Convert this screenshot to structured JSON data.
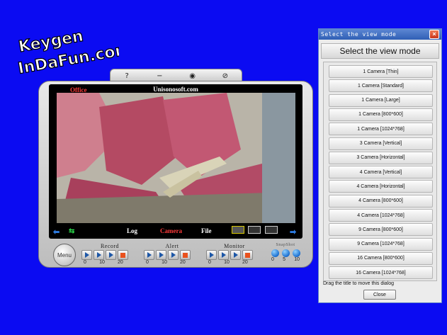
{
  "watermark": {
    "line1": "Keygen",
    "line2": "InDaFun.com"
  },
  "camera_app": {
    "toolbar": {
      "icons": [
        "help-icon",
        "minimize-icon",
        "snapshot-icon",
        "close-icon"
      ],
      "glyphs": [
        "?",
        "−",
        "◉",
        "⊘"
      ]
    },
    "screen_title": "Unisonosoft.com",
    "location_label": "Office",
    "status": {
      "log": "Log",
      "camera": "Camera",
      "file": "File"
    },
    "menu_label": "Menu",
    "record": {
      "title": "Record",
      "ticks": [
        "0",
        "10",
        "20"
      ]
    },
    "alert": {
      "title": "Alert",
      "ticks": [
        "0",
        "10",
        "20"
      ]
    },
    "monitor": {
      "title": "Monitor",
      "ticks": [
        "0",
        "10",
        "20"
      ]
    },
    "snapshot": {
      "title": "SnapShot",
      "ticks": [
        "0",
        "5",
        "10"
      ]
    }
  },
  "dialog": {
    "title": "Select the view mode",
    "heading": "Select the view mode",
    "options": [
      "1 Camera [Thin]",
      "1 Camera [Standard]",
      "1 Camera [Large]",
      "1 Camera [800*600]",
      "1 Camera [1024*768]",
      "3 Camera [Vertical]",
      "3 Camera [Horizontal]",
      "4 Camera [Vertical]",
      "4 Camera [Horizontal]",
      "4 Camera [800*600]",
      "4 Camera [1024*768]",
      "9 Camera [800*600]",
      "9 Camera [1024*768]",
      "16 Camera [800*600]",
      "16 Camera [1024*768]"
    ],
    "hint": "Drag the title to move this dialog",
    "close_label": "Close"
  },
  "colors": {
    "background": "#0b0bf2",
    "accent_red": "#ff3a3a",
    "title_bar": "#2f5fb5"
  }
}
